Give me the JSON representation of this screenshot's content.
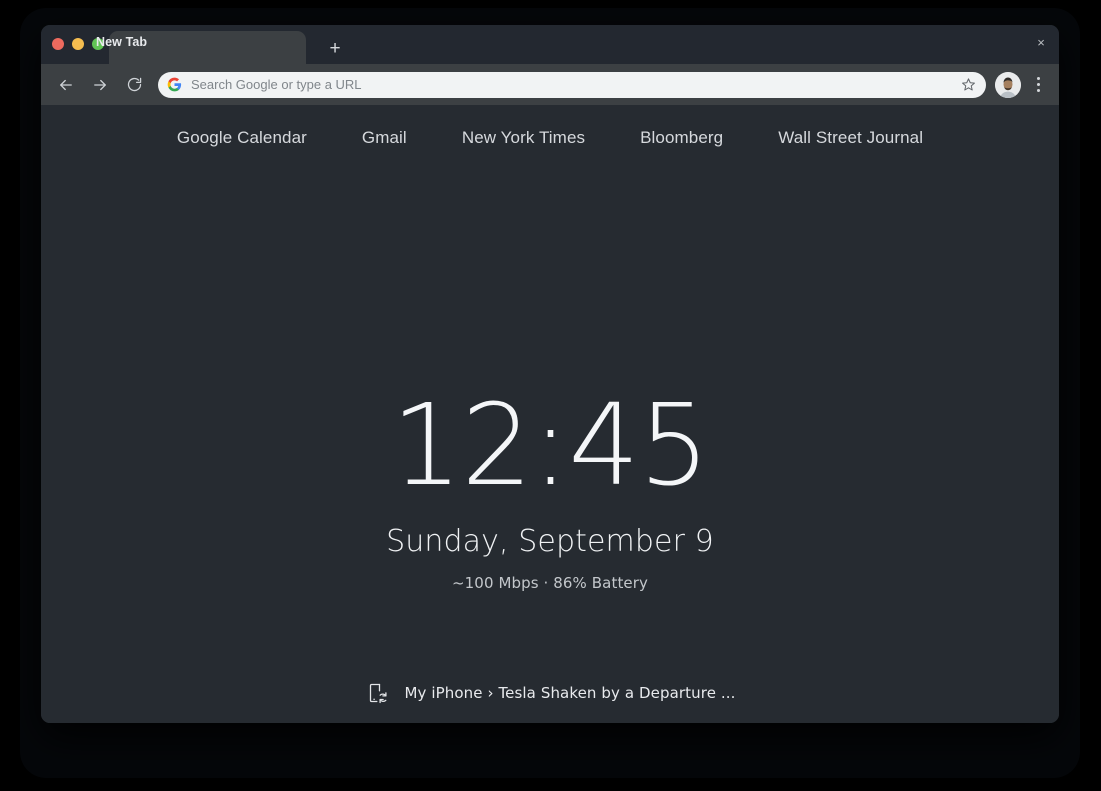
{
  "window": {
    "traffic_lights": [
      {
        "name": "close",
        "color": "#ed6a5e"
      },
      {
        "name": "minimize",
        "color": "#f5bd4f"
      },
      {
        "name": "zoom",
        "color": "#61c554"
      }
    ]
  },
  "tabstrip": {
    "tab_title": "New Tab",
    "close_glyph": "×",
    "new_tab_glyph": "+"
  },
  "toolbar": {
    "back_icon": "back-arrow-icon",
    "forward_icon": "forward-arrow-icon",
    "reload_icon": "reload-icon",
    "omnibox_value": "",
    "omnibox_placeholder": "Search Google or type a URL",
    "google_icon": "google-g-icon",
    "bookmark_icon": "star-outline-icon",
    "profile_icon": "avatar",
    "menu_icon": "three-dot-menu-icon"
  },
  "ntp": {
    "shortcuts": [
      {
        "label": "Google Calendar"
      },
      {
        "label": "Gmail"
      },
      {
        "label": "New York Times"
      },
      {
        "label": "Bloomberg"
      },
      {
        "label": "Wall Street Journal"
      }
    ],
    "clock": "12:45",
    "date": "Sunday, September 9",
    "status": "~100 Mbps · 86% Battery",
    "bottom": {
      "icon": "device-sync-icon",
      "label": "My iPhone › Tesla Shaken by a Departure ..."
    }
  },
  "colors": {
    "desktop_background": "#000000",
    "tabstrip_background": "#232830",
    "active_tab_background": "#3c4043",
    "toolbar_background": "#3c4043",
    "omnibox_background": "#f1f3f4",
    "page_background": "#262b31",
    "primary_text": "#e8eaed",
    "secondary_text": "#c3c7cb"
  }
}
